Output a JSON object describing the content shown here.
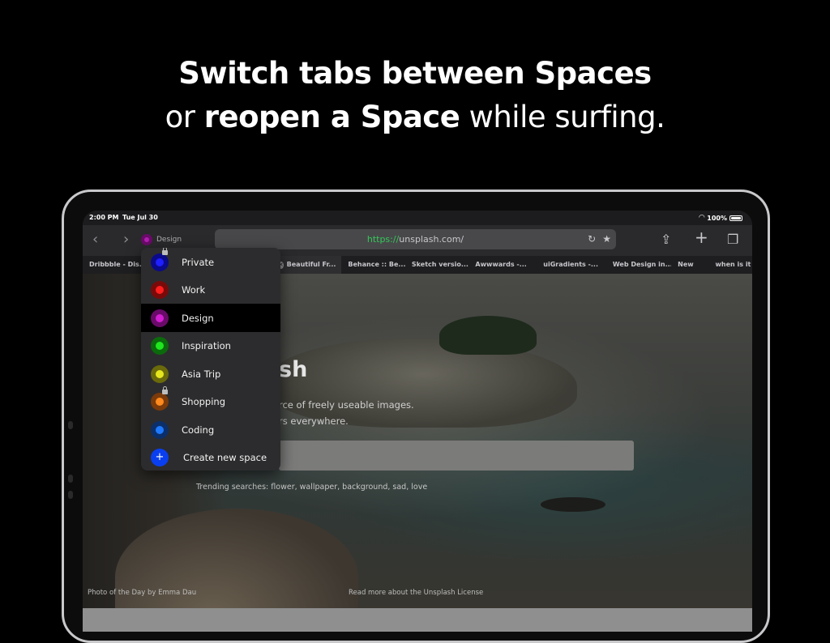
{
  "headline": {
    "line1": "Switch tabs between Spaces",
    "line2_pre": "or ",
    "line2_bold": "reopen a Space",
    "line2_post": " while surfing."
  },
  "status_bar": {
    "time": "2:00 PM",
    "date": "Tue Jul 30",
    "battery": "100%"
  },
  "toolbar": {
    "current_space": "Design",
    "url_scheme": "https://",
    "url_host": "unsplash.com/"
  },
  "tabs": [
    "Dribbble - Dis...",
    "Beautiful Fr...",
    "Behance :: Be...",
    "Sketch versio...",
    "Awwwards -...",
    "uiGradients -...",
    "Web Design in...",
    "New",
    "when is it"
  ],
  "page": {
    "title_fragment": "sh",
    "subtitle_line1": "rce of freely useable images.",
    "subtitle_line2": "rs everywhere.",
    "trending": "Trending searches: flower, wallpaper, background, sad, love",
    "credit_pre": "Photo of the Day",
    "credit_by": "by",
    "credit_name": "Emma Dau",
    "license_pre": "Read more about the",
    "license_link": "Unsplash License"
  },
  "spaces_menu": {
    "items": [
      {
        "label": "Private",
        "ring": "#0a0a8a",
        "core": "#1f1fff",
        "locked": true
      },
      {
        "label": "Work",
        "ring": "#7a0a0a",
        "core": "#ff1f1f",
        "locked": false
      },
      {
        "label": "Design",
        "ring": "#6a0b6a",
        "core": "#d21fd2",
        "locked": false
      },
      {
        "label": "Inspiration",
        "ring": "#0b6a0b",
        "core": "#1fe61f",
        "locked": false
      },
      {
        "label": "Asia Trip",
        "ring": "#6a6a0b",
        "core": "#e6e61f",
        "locked": false
      },
      {
        "label": "Shopping",
        "ring": "#7a3a0a",
        "core": "#ff8a1f",
        "locked": true
      },
      {
        "label": "Coding",
        "ring": "#0b2f6a",
        "core": "#1f7aff",
        "locked": false
      }
    ],
    "create_label": "Create new space",
    "selected": "Design"
  }
}
